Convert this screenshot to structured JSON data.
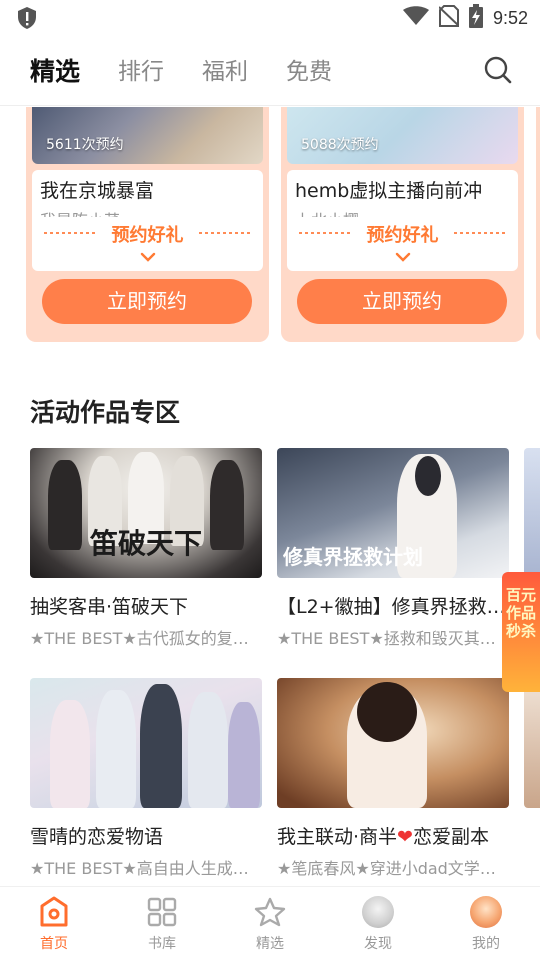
{
  "status_bar": {
    "time": "9:52"
  },
  "header": {
    "tabs": [
      {
        "label": "精选"
      },
      {
        "label": "排行"
      },
      {
        "label": "福利"
      },
      {
        "label": "免费"
      }
    ]
  },
  "reservations": [
    {
      "count": "5611次预约",
      "title": "我在京城暴富",
      "author": "我是陈小芹",
      "gift": "预约好礼",
      "button": "立即预约"
    },
    {
      "count": "5088次预约",
      "title": "hemb虚拟主播向前冲",
      "author": "上北小樱",
      "gift": "预约好礼",
      "button": "立即预约"
    }
  ],
  "section": {
    "title": "活动作品专区"
  },
  "books": [
    {
      "title": "抽奖客串·笛破天下",
      "desc": "★THE BEST★古代孤女的复…",
      "cover_text": "笛破天下"
    },
    {
      "title": "【L2+徽抽】修真界拯救…",
      "desc": "★THE BEST★拯救和毁灭其…",
      "cover_text": "修真界拯救计划"
    },
    {
      "title": "雪晴的恋爱物语",
      "desc": "★THE BEST★高自由人生成长，多样人生任你选"
    },
    {
      "title_a": "我主联动·商半",
      "title_b": "恋爱副本",
      "desc": "★笔底春风★穿进小dad文学网游，开启海王之路"
    }
  ],
  "float_ad": {
    "text": "百元作品秒杀"
  },
  "bottom_nav": [
    {
      "label": "首页"
    },
    {
      "label": "书库"
    },
    {
      "label": "精选"
    },
    {
      "label": "发现"
    },
    {
      "label": "我的"
    }
  ],
  "colors": {
    "accent": "#ff7f4a",
    "card_bg": "#ffd9c8",
    "active_nav": "#ff6d2d"
  }
}
